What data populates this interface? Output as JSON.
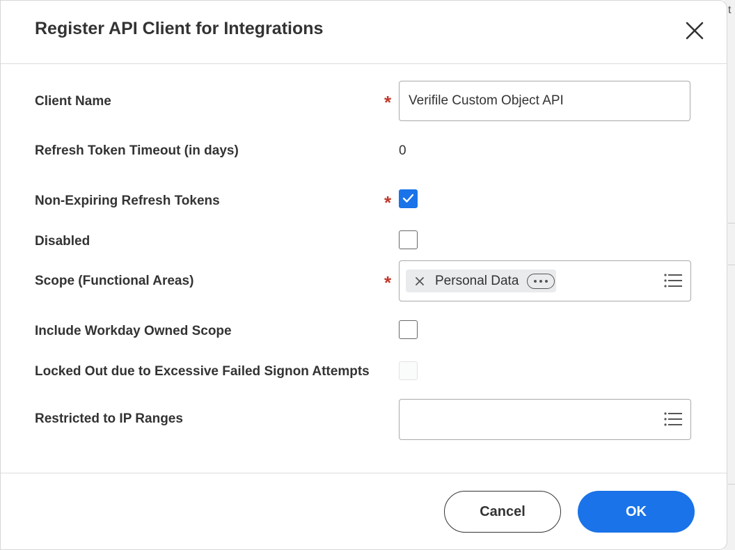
{
  "dialog": {
    "title": "Register API Client for Integrations"
  },
  "fields": {
    "client_name": {
      "label": "Client Name",
      "required": "*",
      "value": "Verifile Custom Object API"
    },
    "refresh_timeout": {
      "label": "Refresh Token Timeout (in days)",
      "value": "0"
    },
    "non_expiring": {
      "label": "Non-Expiring Refresh Tokens",
      "required": "*",
      "checked": true
    },
    "disabled": {
      "label": "Disabled",
      "checked": false
    },
    "scope": {
      "label": "Scope (Functional Areas)",
      "required": "*",
      "pill": "Personal Data"
    },
    "include_workday": {
      "label": "Include Workday Owned Scope",
      "checked": false
    },
    "locked_out": {
      "label": "Locked Out due to Excessive Failed Signon Attempts",
      "checked": false
    },
    "ip_ranges": {
      "label": "Restricted to IP Ranges",
      "value": ""
    }
  },
  "buttons": {
    "cancel": "Cancel",
    "ok": "OK"
  },
  "background": {
    "peek_char": "t"
  },
  "colors": {
    "accent": "#1a73e8",
    "required": "#c0392b",
    "pill_bg": "#e9ebed"
  },
  "icons": [
    "close-icon",
    "checkmark-icon",
    "remove-x-icon",
    "more-options-icon",
    "list-icon"
  ]
}
